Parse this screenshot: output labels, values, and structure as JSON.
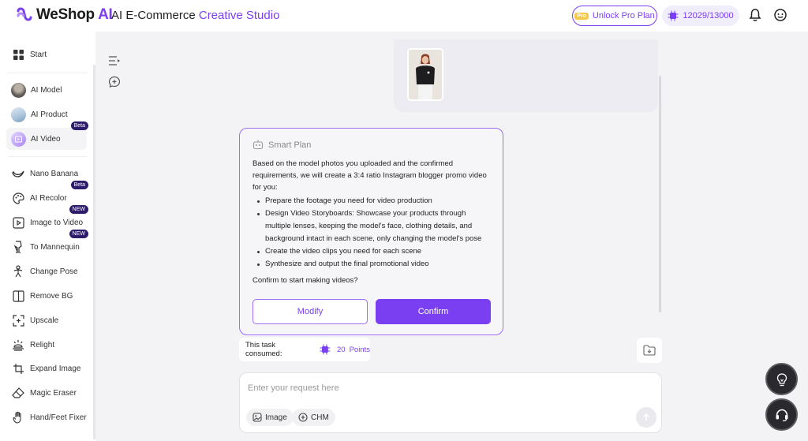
{
  "header": {
    "logo_text": "WeShop",
    "logo_ai": "AI",
    "title_main": "AI E-Commerce ",
    "title_accent": "Creative Studio",
    "pro_tag": "Pro",
    "pro_label": "Unlock Pro Plan",
    "points": "12029/13000"
  },
  "sidebar": {
    "items": [
      {
        "label": "Start",
        "icon": "grid-icon"
      },
      {
        "label": "AI Model",
        "icon": "model-thumb"
      },
      {
        "label": "AI Product",
        "icon": "product-thumb"
      },
      {
        "label": "AI Video",
        "icon": "video-thumb",
        "badge": "Beta"
      },
      {
        "label": "Nano Banana",
        "icon": "banana-icon"
      },
      {
        "label": "AI Recolor",
        "icon": "palette-icon",
        "badge": "Beta"
      },
      {
        "label": "Image to Video",
        "icon": "image-video-icon",
        "badge": "NEW"
      },
      {
        "label": "To Mannequin",
        "icon": "mannequin-icon",
        "badge": "NEW"
      },
      {
        "label": "Change Pose",
        "icon": "pose-icon"
      },
      {
        "label": "Remove BG",
        "icon": "remove-bg-icon"
      },
      {
        "label": "Upscale",
        "icon": "upscale-icon"
      },
      {
        "label": "Relight",
        "icon": "relight-icon"
      },
      {
        "label": "Expand Image",
        "icon": "expand-icon"
      },
      {
        "label": "Magic Eraser",
        "icon": "eraser-icon"
      },
      {
        "label": "Hand/Feet Fixer",
        "icon": "hand-icon"
      }
    ]
  },
  "plan": {
    "title": "Smart Plan",
    "intro": "Based on the model photos you uploaded and the confirmed requirements, we will create a 3:4 ratio Instagram blogger promo video for you:",
    "steps": [
      "Prepare the footage you need for video production",
      "Design Video Storyboards: Showcase your products through multiple lenses, keeping the model's face, clothing details, and background intact in each scene, only changing the model's pose",
      "Create the video clips you need for each scene",
      "Synthesize and output the final promotional video"
    ],
    "question": "Confirm to start making videos?",
    "modify_label": "Modify",
    "confirm_label": "Confirm"
  },
  "consumed": {
    "label": "This task consumed:",
    "amount": "20",
    "unit": "Points"
  },
  "composer": {
    "placeholder": "Enter your request here",
    "chip_image": "Image",
    "chip_chm": "CHM"
  },
  "colors": {
    "accent": "#7b3ff2",
    "badge": "#2d1b6b"
  }
}
